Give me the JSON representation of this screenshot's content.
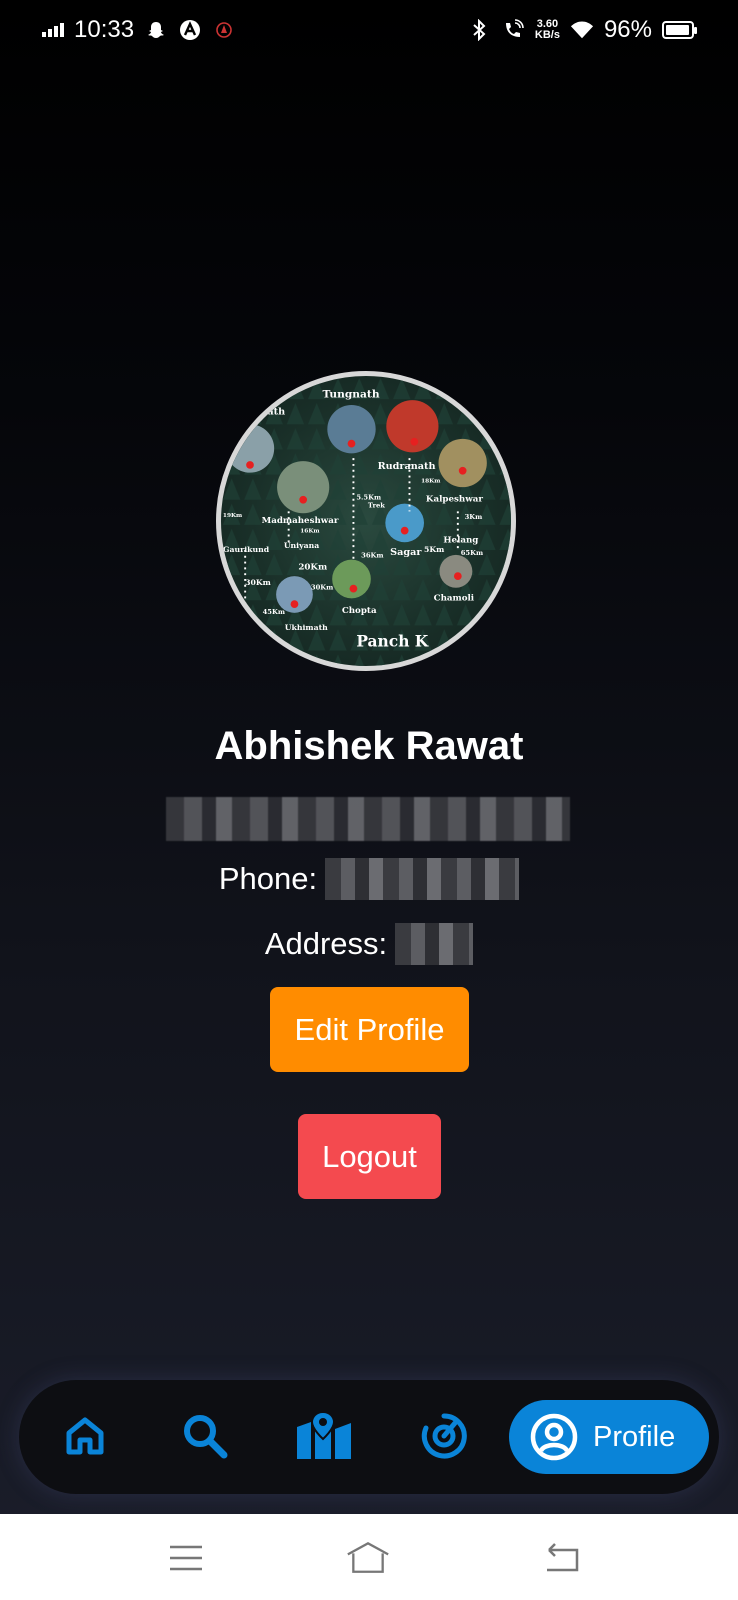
{
  "status_bar": {
    "time": "10:33",
    "speed_value": "3.60",
    "speed_unit": "KB/s",
    "battery_percent": "96%",
    "battery_level": 0.96
  },
  "profile": {
    "avatar_labels": {
      "tungnath": "Tungnath",
      "ath": "ath",
      "rudranath": "Rudranath",
      "kalpeshwar": "Kalpeshwar",
      "madmaheshwar": "Madmaheshwar",
      "uniyana": "Uniyana",
      "gaurikund": "Gaurikund",
      "sagar": "Sagar",
      "helang": "Helang",
      "chopta": "Chopta",
      "chamoli": "Chamoli",
      "ukhimath": "Ukhimath",
      "panch": "Panch K",
      "dist_20km": "20Km",
      "dist_30km_a": "30Km",
      "dist_30km_b": "30Km",
      "dist_45km": "45Km",
      "dist_36km": "36Km",
      "dist_5km": "5Km",
      "dist_65km": "65Km",
      "trek_55": "5.5Km",
      "trek_18a": "18Km",
      "trek_19": "19Km",
      "trek_16": "16Km",
      "trek_3": "3Km",
      "trek_word": "Trek"
    },
    "name": "Abhishek Rawat",
    "phone_label": "Phone:",
    "address_label": "Address:"
  },
  "actions": {
    "edit_label": "Edit Profile",
    "logout_label": "Logout"
  },
  "bottom_nav": {
    "items": [
      {
        "name": "home",
        "icon": "home-icon"
      },
      {
        "name": "search",
        "icon": "search-icon"
      },
      {
        "name": "map",
        "icon": "map-icon"
      },
      {
        "name": "radar",
        "icon": "radar-icon"
      },
      {
        "name": "profile",
        "icon": "user-circle-icon",
        "label": "Profile"
      }
    ],
    "active_color": "#0a84d8"
  },
  "colors": {
    "edit_button": "#ff8c00",
    "logout_button": "#f44a4f",
    "nav_icon": "#0a84d8"
  }
}
